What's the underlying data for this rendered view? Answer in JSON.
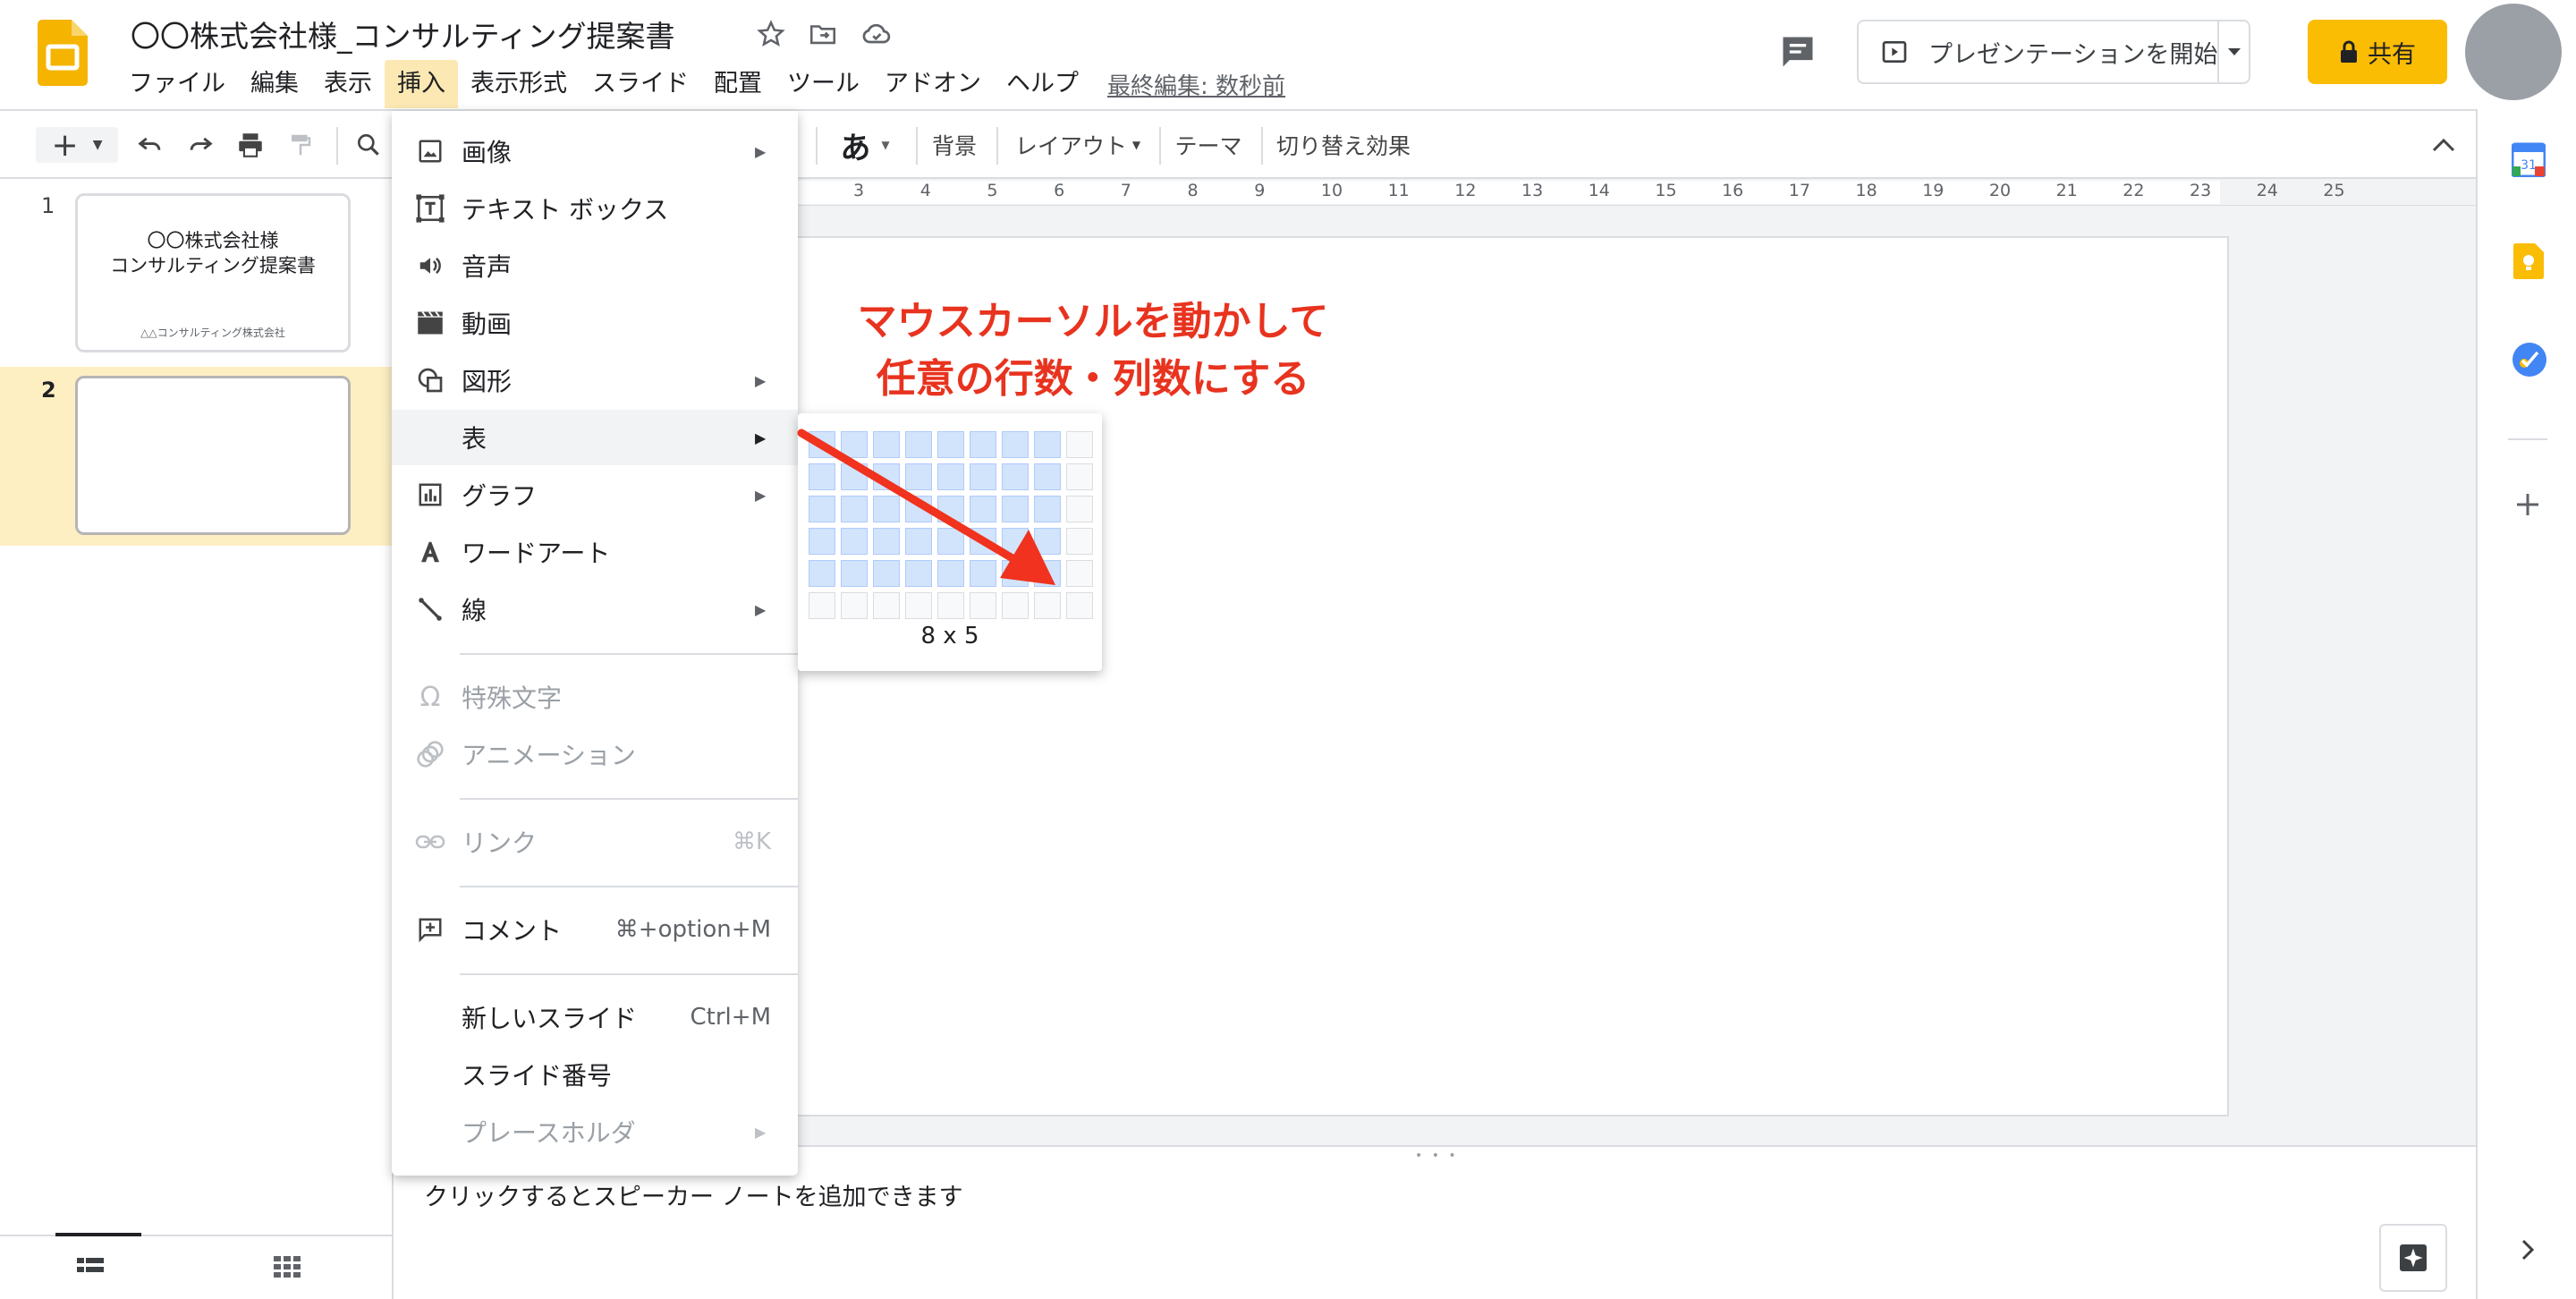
{
  "header": {
    "title": "〇〇株式会社様_コンサルティング提案書",
    "menus": [
      "ファイル",
      "編集",
      "表示",
      "挿入",
      "表示形式",
      "スライド",
      "配置",
      "ツール",
      "アドオン",
      "ヘルプ"
    ],
    "last_edit": "最終編集: 数秒前",
    "present_label": "プレゼンテーションを開始",
    "share_label": "共有"
  },
  "toolbar": {
    "font_label": "あ",
    "background": "背景",
    "layout": "レイアウト",
    "theme": "テーマ",
    "transition": "切り替え効果"
  },
  "ruler": [
    "3",
    "4",
    "5",
    "6",
    "7",
    "8",
    "9",
    "10",
    "11",
    "12",
    "13",
    "14",
    "15",
    "16",
    "17",
    "18",
    "19",
    "20",
    "21",
    "22",
    "23",
    "24",
    "25"
  ],
  "filmstrip": {
    "slides": [
      {
        "number": "1",
        "title_line1": "〇〇株式会社様",
        "title_line2": "コンサルティング提案書",
        "subtitle": "△△コンサルティング株式会社"
      },
      {
        "number": "2"
      }
    ]
  },
  "insert_menu": {
    "items": [
      {
        "label": "画像",
        "icon": "image-icon",
        "submenu": true
      },
      {
        "label": "テキスト ボックス",
        "icon": "textbox-icon"
      },
      {
        "label": "音声",
        "icon": "audio-icon"
      },
      {
        "label": "動画",
        "icon": "video-icon"
      },
      {
        "label": "図形",
        "icon": "shape-icon",
        "submenu": true
      },
      {
        "label": "表",
        "icon": "",
        "submenu": true
      },
      {
        "label": "グラフ",
        "icon": "chart-icon",
        "submenu": true
      },
      {
        "label": "ワードアート",
        "icon": "wordart-icon"
      },
      {
        "label": "線",
        "icon": "line-icon",
        "submenu": true
      },
      {
        "label": "特殊文字",
        "icon": "omega-icon",
        "disabled": true
      },
      {
        "label": "アニメーション",
        "icon": "animation-icon",
        "disabled": true
      },
      {
        "label": "リンク",
        "icon": "link-icon",
        "shortcut": "⌘K",
        "disabled": true
      },
      {
        "label": "コメント",
        "icon": "comment-add-icon",
        "shortcut": "⌘+option+M"
      },
      {
        "label": "新しいスライド",
        "shortcut": "Ctrl+M"
      },
      {
        "label": "スライド番号"
      },
      {
        "label": "プレースホルダ",
        "submenu": true,
        "disabled": true
      }
    ]
  },
  "table_picker": {
    "size_label": "8 x 5",
    "selected_columns": 8,
    "selected_rows": 5,
    "grid_columns": 9,
    "grid_rows": 6
  },
  "annotation": {
    "line1": "マウスカーソルを動かして",
    "line2": "任意の行数・列数にする",
    "color": "#e8331f"
  },
  "notes": {
    "placeholder": "クリックするとスピーカー ノートを追加できます"
  },
  "colors": {
    "brand_yellow": "#fbbc04",
    "menu_active": "#fce8b2",
    "selected_slide": "#feefc3"
  }
}
